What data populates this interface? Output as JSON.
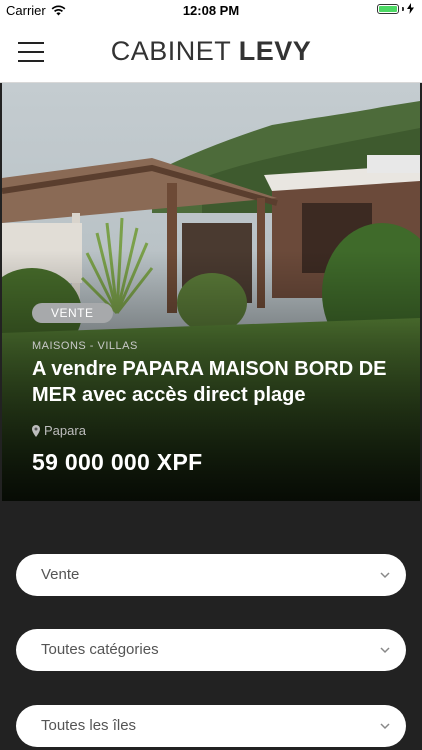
{
  "status_bar": {
    "carrier": "Carrier",
    "time": "12:08 PM",
    "battery_level": 1.0,
    "battery_color": "#4cd964"
  },
  "header": {
    "brand_light": "CABINET",
    "brand_bold": "LEVY",
    "menu_icon": "hamburger-icon"
  },
  "listing": {
    "badge": "VENTE",
    "category": "MAISONS - VILLAS",
    "title": "A vendre PAPARA MAISON BORD DE MER avec accès direct plage",
    "location": "Papara",
    "price": "59 000 000 XPF"
  },
  "filters": [
    {
      "label": "Vente"
    },
    {
      "label": "Toutes catégories"
    },
    {
      "label": "Toutes les îles"
    }
  ],
  "colors": {
    "background_dark": "#222222",
    "badge": "#a7a9ab"
  }
}
